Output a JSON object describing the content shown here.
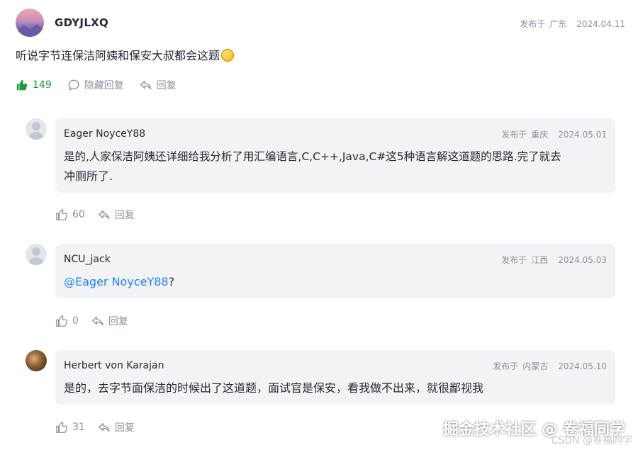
{
  "main_comment": {
    "username": "GDYJLXQ",
    "location_prefix": "发布于",
    "location": "广东",
    "date": "2024.04.11",
    "content": "听说字节连保洁阿姨和保安大叔都会这题",
    "emoji_icon": "grinning-sweat-emoji",
    "likes": "149",
    "hide_replies_label": "隐藏回复",
    "reply_label": "回复",
    "liked_color": "#1d9a3a"
  },
  "replies": [
    {
      "username": "Eager NoyceY88",
      "location_prefix": "发布于",
      "location": "重庆",
      "date": "2024.05.01",
      "content_line1": "是的,人家保洁阿姨还详细给我分析了用汇编语言,C,C++,Java,C#这5种语言解这道题的思路.完了就去",
      "content_line2": "冲厕所了.",
      "likes": "60",
      "reply_label": "回复"
    },
    {
      "username": "NCU_jack",
      "location_prefix": "发布于",
      "location": "江西",
      "date": "2024.05.03",
      "mention": "@Eager NoyceY88",
      "content_tail": "?",
      "likes": "0",
      "reply_label": "回复"
    },
    {
      "username": "Herbert von Karajan",
      "location_prefix": "发布于",
      "location": "内蒙古",
      "date": "2024.05.10",
      "content": "是的，去字节面保洁的时候出了这道题，面试官是保安，看我做不出来，就很鄙视我",
      "likes": "31",
      "reply_label": "回复"
    }
  ],
  "watermark": "掘金技术社区 @ 卷福同学",
  "csdn_watermark": "CSDN @卷福同学",
  "colors": {
    "accent_blue": "#1e80ff",
    "meta_gray": "#8a919f",
    "bubble_bg": "#f2f3f5"
  }
}
